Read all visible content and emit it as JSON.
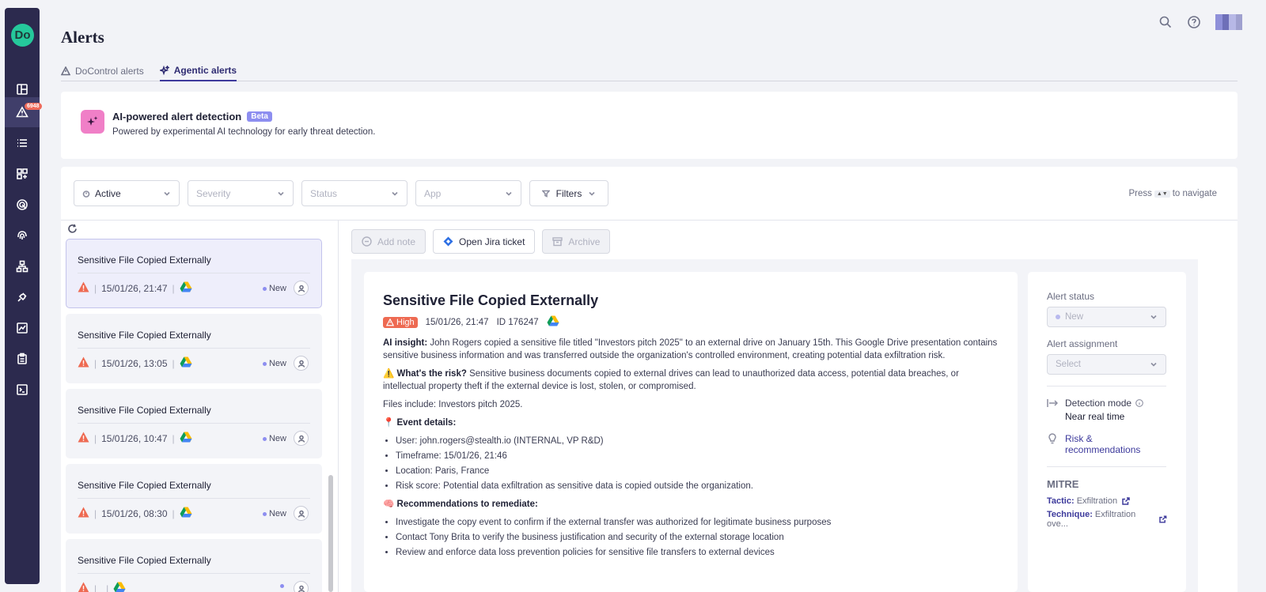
{
  "sidebar": {
    "logo": "Do",
    "badge": "6948",
    "items": [
      "dashboard-icon",
      "alert-icon",
      "list-icon",
      "widgets-icon",
      "radar-icon",
      "fingerprint-icon",
      "hierarchy-icon",
      "plug-icon",
      "chart-icon",
      "clipboard-icon",
      "terminal-icon"
    ]
  },
  "header": {
    "title": "Alerts",
    "avatar_colors": [
      "#8f90d9",
      "#6e6fb8",
      "#b7b8e6",
      "#9fa0cf"
    ]
  },
  "tabs": [
    {
      "label": "DoControl alerts",
      "icon": "warning-icon"
    },
    {
      "label": "Agentic alerts",
      "icon": "sparkles-icon"
    }
  ],
  "banner": {
    "title": "AI-powered alert detection",
    "badge": "Beta",
    "subtitle": "Powered by experimental AI technology for early threat detection."
  },
  "filters": {
    "active": "Active",
    "severity": "Severity",
    "status": "Status",
    "app": "App",
    "filters_button": "Filters",
    "nav_hint_prefix": "Press",
    "nav_hint_keys": "▲▼",
    "nav_hint_suffix": "to navigate"
  },
  "list": [
    {
      "title": "Sensitive File Copied Externally",
      "date": "15/01/26, 21:47",
      "status": "New"
    },
    {
      "title": "Sensitive File Copied Externally",
      "date": "15/01/26, 13:05",
      "status": "New"
    },
    {
      "title": "Sensitive File Copied Externally",
      "date": "15/01/26, 10:47",
      "status": "New"
    },
    {
      "title": "Sensitive File Copied Externally",
      "date": "15/01/26, 08:30",
      "status": "New"
    },
    {
      "title": "Sensitive File Copied Externally",
      "date": "",
      "status": ""
    }
  ],
  "actions": {
    "add_note": "Add note",
    "jira": "Open Jira ticket",
    "archive": "Archive"
  },
  "detail": {
    "title": "Sensitive File Copied Externally",
    "severity": "High",
    "date": "15/01/26, 21:47",
    "id": "ID 176247",
    "insight_label": "AI insight:",
    "insight": " John Rogers copied a sensitive file titled \"Investors pitch 2025\" to an external drive on January 15th. This Google Drive presentation contains sensitive business information and was transferred outside the organization's controlled environment, creating potential data exfiltration risk.",
    "risk_label": "⚠️ What's the risk?",
    "risk": " Sensitive business documents copied to external drives can lead to unauthorized data access, potential data breaches, or intellectual property theft if the external device is lost, stolen, or compromised.",
    "files": "Files include: Investors pitch 2025.",
    "event_label": "📍 Event details:",
    "event_items": [
      "User: john.rogers@stealth.io (INTERNAL, VP R&D)",
      "Timeframe: 15/01/26, 21:46",
      "Location: Paris, France",
      "Risk score: Potential data exfiltration as sensitive data is copied outside the organization."
    ],
    "rec_label": "🧠 Recommendations to remediate:",
    "rec_items": [
      "Investigate the copy event to confirm if the external transfer was authorized for legitimate business purposes",
      "Contact Tony Brita to verify the business justification and security of the external storage location",
      "Review and enforce data loss prevention policies for sensitive file transfers to external devices"
    ]
  },
  "side": {
    "status_label": "Alert status",
    "status_value": "New",
    "assign_label": "Alert assignment",
    "assign_placeholder": "Select",
    "detection_label": "Detection mode",
    "detection_value": "Near real time",
    "risk_link": "Risk & recommendations",
    "mitre": "MITRE",
    "tactic_label": "Tactic:",
    "tactic_value": "Exfiltration",
    "technique_label": "Technique:",
    "technique_value": "Exfiltration ove..."
  },
  "colors": {
    "sidebar": "#2c2a4e",
    "accent": "#3d3a9c",
    "severity_high": "#ee6a52",
    "logo": "#25c89b"
  }
}
